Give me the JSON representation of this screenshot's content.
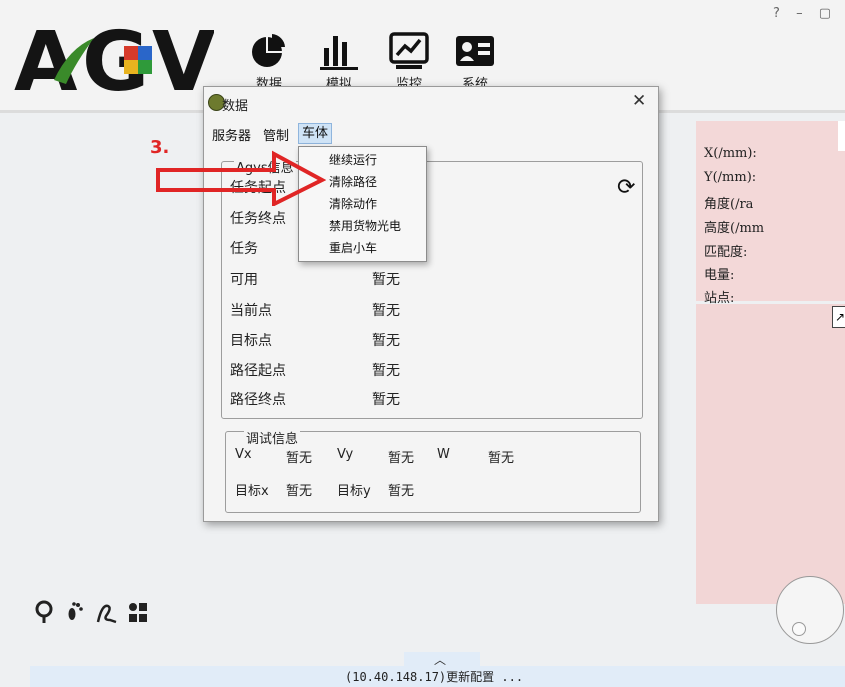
{
  "app": {
    "logo_text": "AGV",
    "toolbar": [
      {
        "name": "数据",
        "icon": "pie-chart-icon"
      },
      {
        "name": "模拟",
        "icon": "bar-chart-icon"
      },
      {
        "name": "监控",
        "icon": "line-chart-icon"
      },
      {
        "name": "系统",
        "icon": "id-card-icon"
      }
    ],
    "window_controls": "? – ▢"
  },
  "right_panel": {
    "labels": [
      "X(/mm):",
      "Y(/mm):",
      "角度(/ra",
      "高度(/mm",
      "匹配度:",
      "电量:",
      "站点:"
    ]
  },
  "dialog": {
    "title": "数据",
    "menu": [
      "服务器",
      "管制",
      "车体"
    ],
    "agv_group_title": "Agvs信息",
    "rows": [
      {
        "label": "任务起点",
        "value": ""
      },
      {
        "label": "任务终点",
        "value": ""
      },
      {
        "label": "任务",
        "value": ""
      },
      {
        "label": "可用",
        "value": "暂无"
      },
      {
        "label": "当前点",
        "value": "暂无"
      },
      {
        "label": "目标点",
        "value": "暂无"
      },
      {
        "label": "路径起点",
        "value": "暂无"
      },
      {
        "label": "路径终点",
        "value": "暂无"
      }
    ],
    "debug_title": "调试信息",
    "debug": {
      "vx_label": "Vx",
      "vx_value": "暂无",
      "vy_label": "Vy",
      "vy_value": "暂无",
      "w_label": "W",
      "w_value": "暂无",
      "tx_label": "目标x",
      "tx_value": "暂无",
      "ty_label": "目标y",
      "ty_value": "暂无"
    },
    "dropdown": [
      "继续运行",
      "清除路径",
      "清除动作",
      "禁用货物光电",
      "重启小车"
    ]
  },
  "annotation": {
    "step": "3.",
    "color": "#e02525"
  },
  "status_bar": {
    "text": "(10.40.148.17)更新配置 ..."
  }
}
